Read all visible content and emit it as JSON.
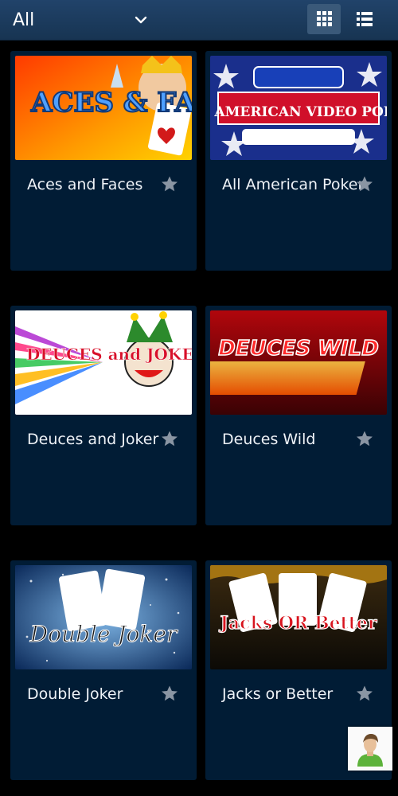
{
  "filter": {
    "label": "All"
  },
  "toolbar": {
    "grid_icon": "grid-view-icon",
    "list_icon": "list-view-icon",
    "colors": {
      "bar": "#1f3f63",
      "active_button": "#3a5979"
    }
  },
  "games": [
    {
      "title": "Aces and Faces",
      "thumb_text": "ACES & FACES"
    },
    {
      "title": "All American Poker",
      "thumb_text": "ALL AMERICAN VIDEO POKER"
    },
    {
      "title": "Deuces and Joker",
      "thumb_text": "DEUCES and JOKERS"
    },
    {
      "title": "Deuces Wild",
      "thumb_text": "DEUCES WILD"
    },
    {
      "title": "Double Joker",
      "thumb_text": "Double Joker"
    },
    {
      "title": "Jacks or Better",
      "thumb_text": "Jacks OR Better"
    }
  ],
  "colors": {
    "tile_bg": "#011c35",
    "page_bg": "#000000",
    "star": "#8a95a3"
  },
  "chat_button": {
    "icon": "user-avatar-icon"
  }
}
